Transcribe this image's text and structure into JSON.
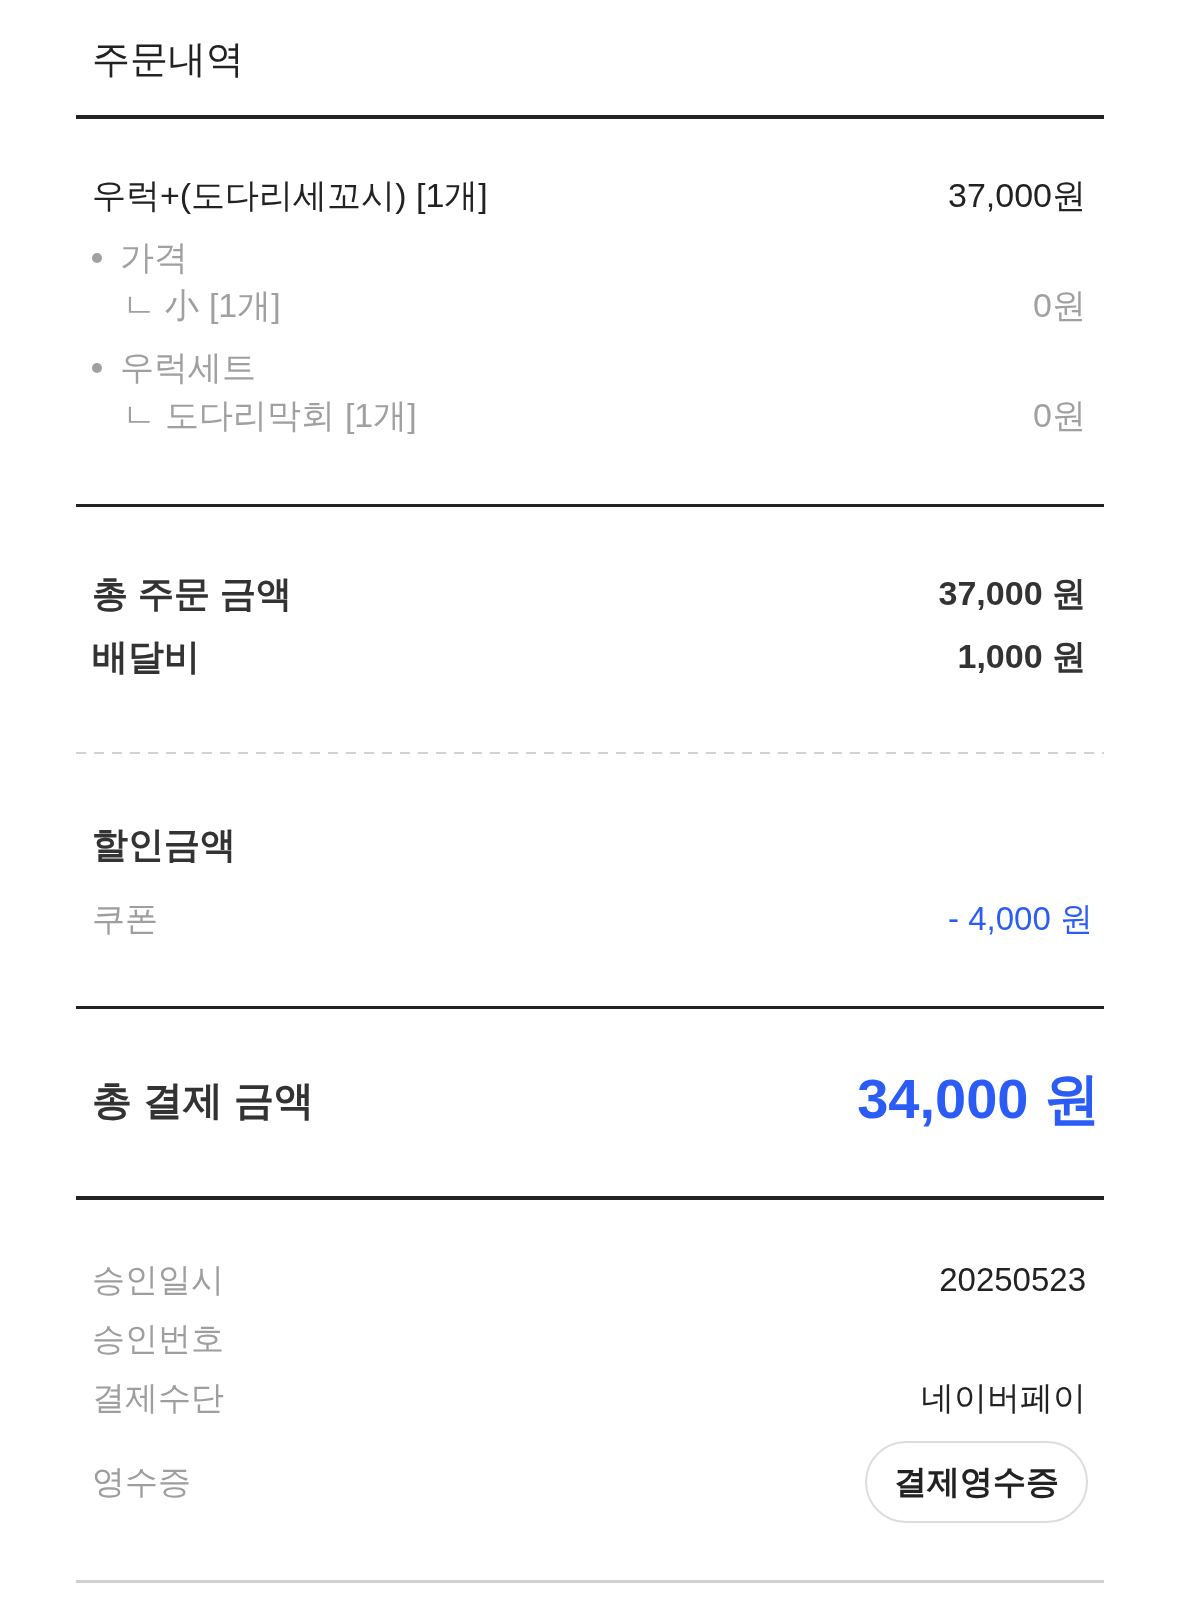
{
  "header": {
    "title": "주문내역"
  },
  "order_items": [
    {
      "name": "우럭+(도다리세꼬시) [1개]",
      "price": "37,000원",
      "option_groups": [
        {
          "title": "가격",
          "options": [
            {
              "name": "ㄴ 小 [1개]",
              "price": "0원"
            }
          ]
        },
        {
          "title": "우럭세트",
          "options": [
            {
              "name": "ㄴ 도다리막회 [1개]",
              "price": "0원"
            }
          ]
        }
      ]
    }
  ],
  "summary": [
    {
      "label": "총 주문 금액",
      "value": "37,000 원"
    },
    {
      "label": "배달비",
      "value": "1,000 원"
    }
  ],
  "discount": {
    "title": "할인금액",
    "items": [
      {
        "label": "쿠폰",
        "value": "- 4,000 원"
      }
    ]
  },
  "total": {
    "label": "총 결제 금액",
    "value": "34,000 원"
  },
  "payment_info": [
    {
      "kind": "text",
      "label": "승인일시",
      "value": "20250523"
    },
    {
      "kind": "text",
      "label": "승인번호"
    },
    {
      "kind": "text",
      "label": "결제수단",
      "value": "네이버페이"
    },
    {
      "kind": "button",
      "label": "영수증",
      "button": "결제영수증"
    }
  ]
}
